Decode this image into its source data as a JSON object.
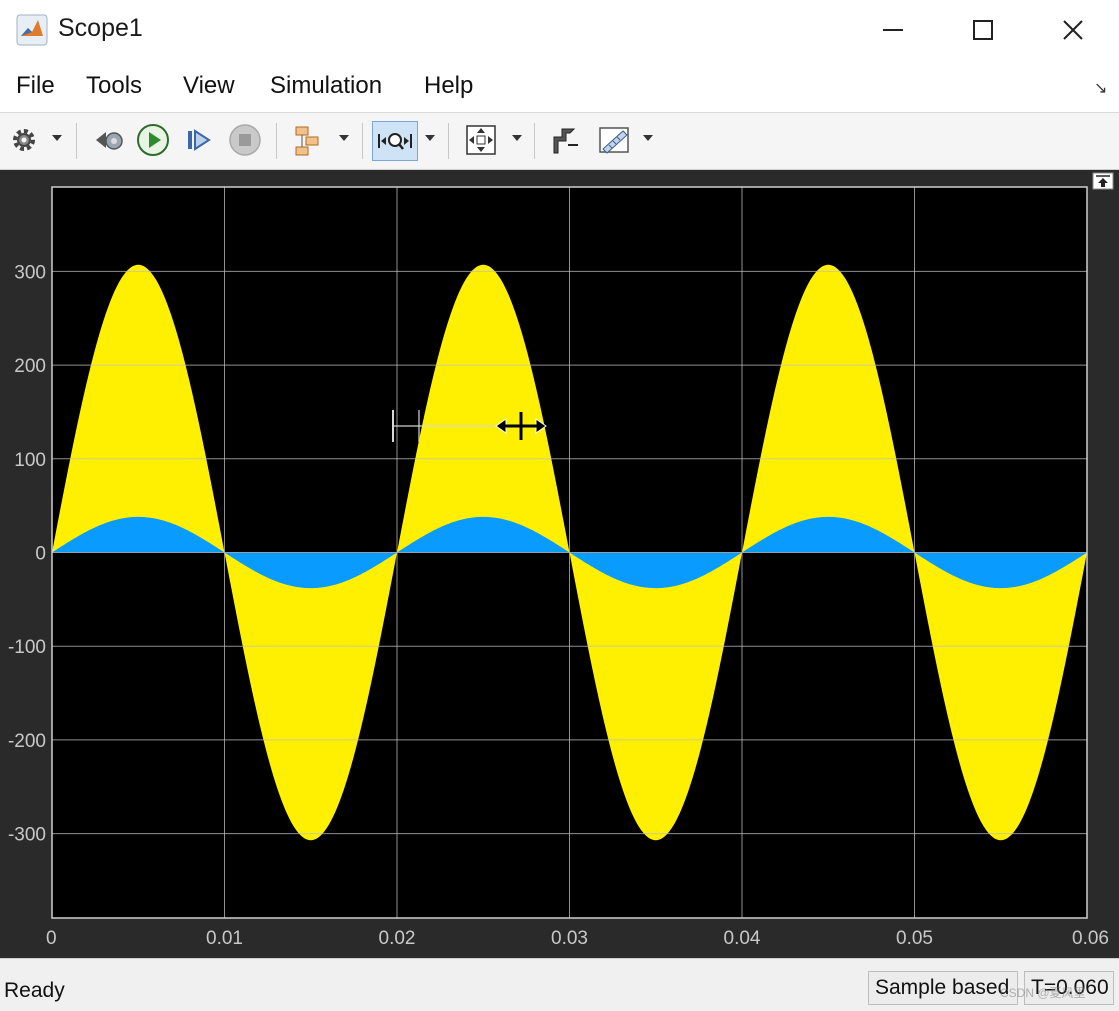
{
  "window": {
    "title": "Scope1",
    "icon": "matlab-icon"
  },
  "menu": {
    "items": [
      "File",
      "Tools",
      "View",
      "Simulation",
      "Help"
    ]
  },
  "toolbar": {
    "icons": [
      "settings-icon",
      "step-back-icon",
      "run-icon",
      "step-forward-icon",
      "stop-icon",
      "highlight-block-icon",
      "zoom-x-icon",
      "autoscale-icon",
      "style-icon",
      "measurements-icon"
    ],
    "active": "zoom-x-icon"
  },
  "status": {
    "left": "Ready",
    "mode": "Sample based",
    "time": "T=0.060"
  },
  "watermark": "CSDN @夏风里",
  "colors": {
    "plot_bg": "#000000",
    "panel_bg": "#2a2a2a",
    "grid": "#bfbfbf",
    "tick_text": "#c8c8c8",
    "series1": "#ffef00",
    "series2": "#0a9bff"
  },
  "chart_data": {
    "type": "area",
    "title": "",
    "xlabel": "",
    "ylabel": "",
    "xlim": [
      0,
      0.06
    ],
    "ylim": [
      -390,
      390
    ],
    "x_ticks": [
      0,
      0.01,
      0.02,
      0.03,
      0.04,
      0.05,
      0.06
    ],
    "x_tick_labels": [
      "0",
      "0.01",
      "0.02",
      "0.03",
      "0.04",
      "0.05",
      "0.06"
    ],
    "y_ticks": [
      -300,
      -200,
      -100,
      0,
      100,
      200,
      300
    ],
    "y_tick_labels": [
      "-300",
      "-200",
      "-100",
      "0",
      "100",
      "200",
      "300"
    ],
    "grid": true,
    "series": [
      {
        "amplitude": 307,
        "frequency_hz": 50,
        "shape": "sine",
        "fill": "dense"
      },
      {
        "amplitude": 38,
        "frequency_hz": 50,
        "shape": "sine",
        "fill": "dense"
      }
    ]
  }
}
